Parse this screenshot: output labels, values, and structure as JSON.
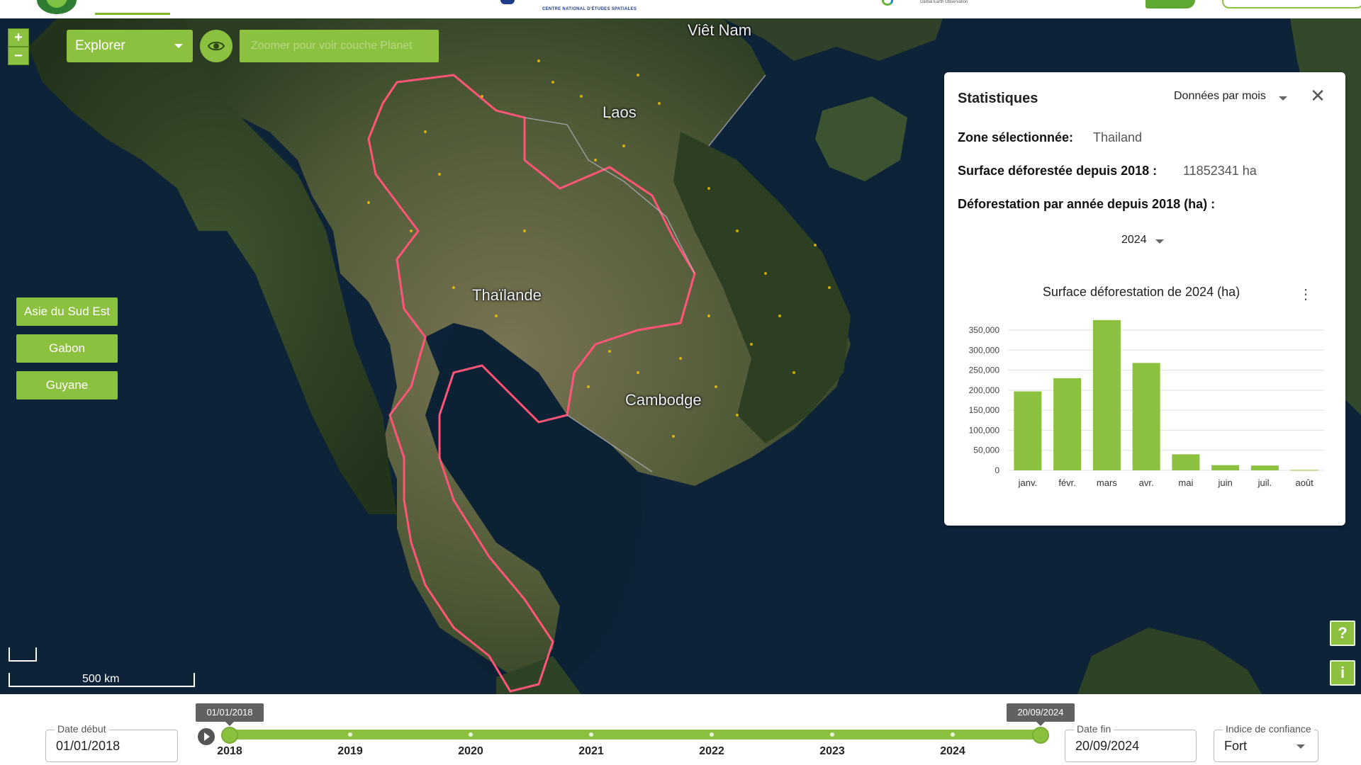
{
  "header": {
    "cnes_tagline": "CENTRE NATIONAL D'ÉTUDES SPATIALES",
    "geo_tagline": "Global Earth Observation"
  },
  "toolbar": {
    "zoom_in": "+",
    "zoom_out": "−",
    "mode_select": "Explorer",
    "planet_button": "Zoomer pour voir couche Planet"
  },
  "map": {
    "labels": {
      "vietnam": "Viêt Nam",
      "laos": "Laos",
      "thailand": "Thaïlande",
      "cambodia": "Cambodge"
    },
    "scale_label": "500 km",
    "colors": {
      "border": "#ff4d6d",
      "hotspot": "#ffcc00",
      "accent": "#8cc13f"
    }
  },
  "regions": [
    "Asie du Sud Est",
    "Gabon",
    "Guyane"
  ],
  "side_buttons": {
    "help": "?",
    "info": "i"
  },
  "stats_panel": {
    "title": "Statistiques",
    "mode": "Données par mois",
    "close": "✕",
    "zone_label": "Zone sélectionnée:",
    "zone_value": "Thailand",
    "surface_label": "Surface déforestée depuis 2018 :",
    "surface_value": "11852341 ha",
    "per_year_label": "Déforestation par année depuis 2018 (ha) :",
    "year": "2024",
    "chart_menu": "⋮"
  },
  "chart_data": {
    "type": "bar",
    "title": "Surface déforestation de 2024 (ha)",
    "categories": [
      "janv.",
      "févr.",
      "mars",
      "avr.",
      "mai",
      "juin",
      "juil.",
      "août"
    ],
    "values": [
      197000,
      230000,
      375000,
      268000,
      40000,
      13000,
      12000,
      1000
    ],
    "ylim": [
      0,
      350000
    ],
    "yticks": [
      "0",
      "50,000",
      "100,000",
      "150,000",
      "200,000",
      "250,000",
      "300,000",
      "350,000"
    ],
    "ytick_values": [
      0,
      50000,
      100000,
      150000,
      200000,
      250000,
      300000,
      350000
    ],
    "color": "#8cc13f",
    "grid": true
  },
  "timeline": {
    "start_label": "Date début",
    "start_value": "01/01/2018",
    "end_label": "Date fin",
    "end_value": "20/09/2024",
    "confidence_label": "Indice de confiance",
    "confidence_value": "Fort",
    "start_tip": "01/01/2018",
    "end_tip": "20/09/2024",
    "years": [
      "2018",
      "2019",
      "2020",
      "2021",
      "2022",
      "2023",
      "2024"
    ]
  }
}
